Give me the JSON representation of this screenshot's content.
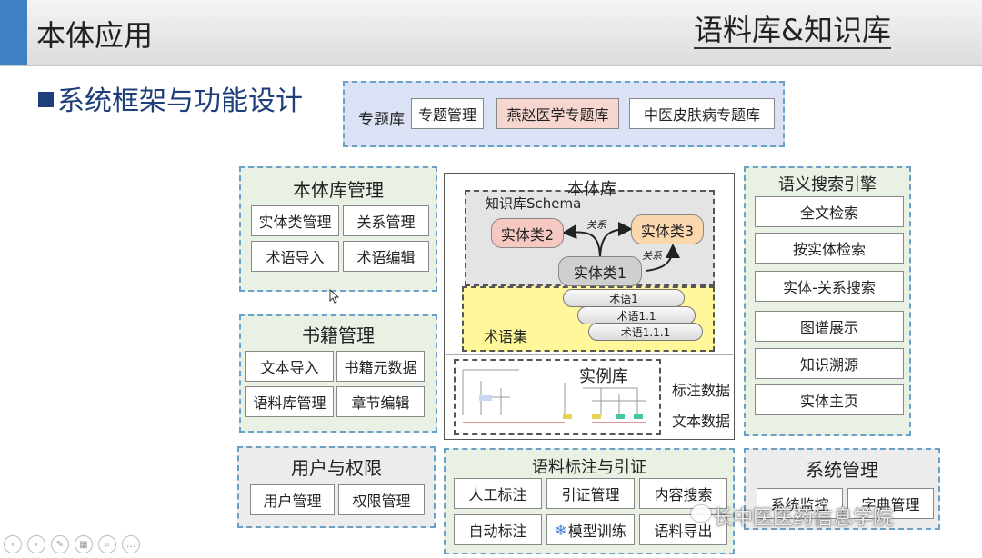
{
  "header": {
    "title": "本体应用",
    "subtitle": "语料库&知识库"
  },
  "section_title": "系统框架与功能设计",
  "topic_library": {
    "label": "专题库",
    "items": [
      "专题管理",
      "燕赵医学专题库",
      "中医皮肤病专题库"
    ]
  },
  "ontology_mgmt": {
    "title": "本体库管理",
    "items": [
      "实体类管理",
      "关系管理",
      "术语导入",
      "术语编辑"
    ]
  },
  "book_mgmt": {
    "title": "书籍管理",
    "items": [
      "文本导入",
      "书籍元数据",
      "语料库管理",
      "章节编辑"
    ]
  },
  "user_perm": {
    "title": "用户与权限",
    "items": [
      "用户管理",
      "权限管理"
    ]
  },
  "ontology_lib": {
    "title": "本体库",
    "schema_label": "知识库Schema",
    "entities": [
      "实体类2",
      "实体类3",
      "实体类1"
    ],
    "relation_label": "关系",
    "termset_label": "术语集",
    "terms": [
      "术语1",
      "术语1.1",
      "术语1.1.1"
    ],
    "instance_label": "实例库",
    "side_labels": [
      "标注数据",
      "文本数据"
    ]
  },
  "corpus_annot": {
    "title": "语料标注与引证",
    "items": [
      "人工标注",
      "引证管理",
      "内容搜索",
      "自动标注",
      "模型训练",
      "语料导出"
    ]
  },
  "semantic_search": {
    "title": "语义搜索引擎",
    "items": [
      "全文检索",
      "按实体检索",
      "实体-关系搜索",
      "图谱展示",
      "知识溯源",
      "实体主页"
    ]
  },
  "system_mgmt": {
    "title": "系统管理",
    "items": [
      "系统监控",
      "字典管理"
    ]
  },
  "watermark": "长中医医药信息学院",
  "icons": [
    "snowflake-icon",
    "cursor-icon",
    "wechat-icon"
  ],
  "colors": {
    "accent": "#3f7fc3",
    "panel_green": "#e8f1e4",
    "panel_gray": "#ececec",
    "panel_blue": "#dbe2f5",
    "pink": "#f6d6cf",
    "yellow": "#fff799"
  }
}
